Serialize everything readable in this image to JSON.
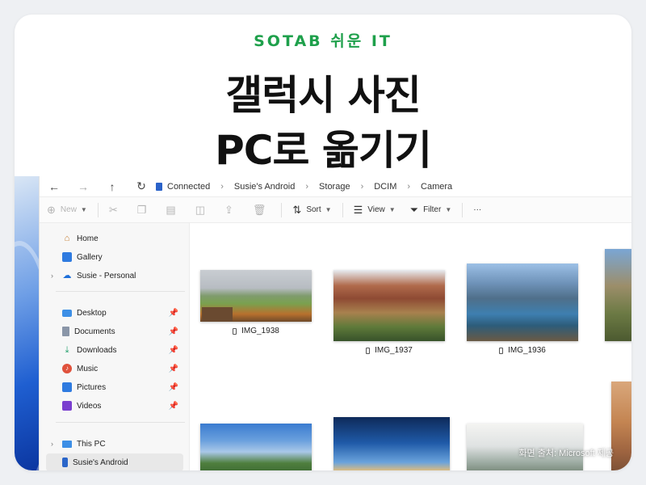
{
  "header": {
    "brand": "SOTAB 쉬운 IT",
    "title_line1": "갤럭시 사진",
    "title_line2": "PC로 옮기기"
  },
  "address_bar": {
    "back_icon": "←",
    "forward_icon": "→",
    "up_icon": "↑",
    "refresh_icon": "↻",
    "breadcrumbs": [
      "Connected",
      "Susie's Android",
      "Storage",
      "DCIM",
      "Camera"
    ]
  },
  "toolbar": {
    "new_label": "New",
    "sort_label": "Sort",
    "view_label": "View",
    "filter_label": "Filter",
    "more_icon": "···"
  },
  "sidebar": {
    "items": [
      {
        "label": "Home",
        "icon": "home-icon"
      },
      {
        "label": "Gallery",
        "icon": "gallery-icon"
      },
      {
        "label": "Susie - Personal",
        "icon": "onedrive-cloud-icon"
      },
      {
        "label": "Desktop",
        "icon": "desktop-icon"
      },
      {
        "label": "Documents",
        "icon": "documents-icon"
      },
      {
        "label": "Downloads",
        "icon": "downloads-icon"
      },
      {
        "label": "Music",
        "icon": "music-icon"
      },
      {
        "label": "Pictures",
        "icon": "pictures-icon"
      },
      {
        "label": "Videos",
        "icon": "videos-icon"
      },
      {
        "label": "This PC",
        "icon": "pc-icon"
      },
      {
        "label": "Susie's Android",
        "icon": "phone-icon"
      }
    ]
  },
  "files": [
    {
      "name": "IMG_1938"
    },
    {
      "name": "IMG_1937"
    },
    {
      "name": "IMG_1936"
    }
  ],
  "credit": "화면 출처: Microsoft 제공",
  "colors": {
    "brand": "#1ea04b",
    "folder_accent": "#2a62c9",
    "selected_bg": "#e8e8e8"
  }
}
